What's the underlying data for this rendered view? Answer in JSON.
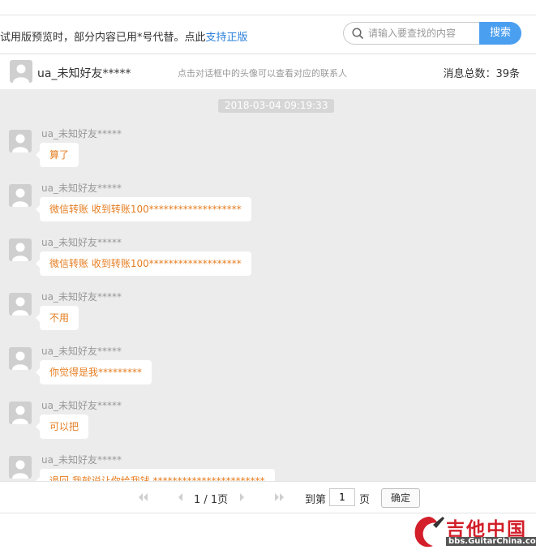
{
  "topbar": {
    "notice_text": "试用版预览时，部分内容已用*号代替。点此",
    "notice_link": "支持正版",
    "search_placeholder": "请输入要查找的内容",
    "search_button": "搜索"
  },
  "conversation": {
    "contact_name": "ua_未知好友*****",
    "hint": "点击对话框中的头像可以查看对应的联系人",
    "total_label": "消息总数：39条"
  },
  "chat": {
    "timestamp": "2018-03-04 09:19:33",
    "messages": [
      {
        "sender": "ua_未知好友*****",
        "text": "算了"
      },
      {
        "sender": "ua_未知好友*****",
        "text": "微信转账 收到转账100*******************"
      },
      {
        "sender": "ua_未知好友*****",
        "text": "微信转账 收到转账100*******************"
      },
      {
        "sender": "ua_未知好友*****",
        "text": "不用"
      },
      {
        "sender": "ua_未知好友*****",
        "text": "你觉得是我*********"
      },
      {
        "sender": "ua_未知好友*****",
        "text": "可以把"
      },
      {
        "sender": "ua_未知好友*****",
        "text": "退回 我就说让你给我钱 ***********************"
      }
    ]
  },
  "pager": {
    "page_info": "1 / 1页",
    "goto_label": "到第",
    "page_value": "1",
    "page_unit": "页",
    "confirm": "确定"
  },
  "watermark": {
    "title": "吉他中国",
    "url": "bbs.GuitarChina.com"
  },
  "colors": {
    "accent": "#4a9ff0",
    "message_text": "#e67e22",
    "link": "#2a7fd9",
    "chat_bg": "#ececec"
  }
}
